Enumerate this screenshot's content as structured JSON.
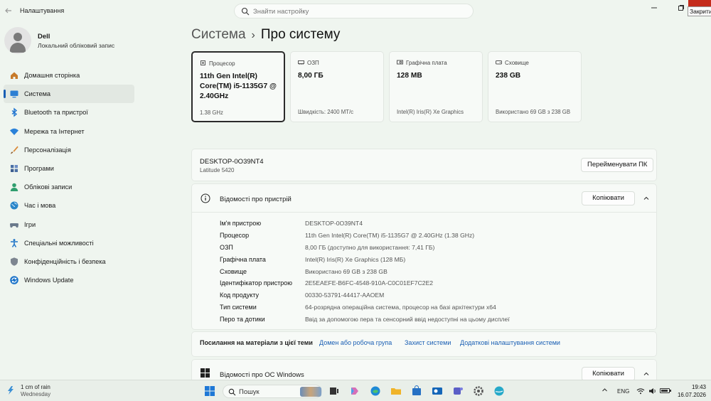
{
  "window": {
    "app_title": "Налаштування",
    "search_placeholder": "Знайти настройку",
    "close_tooltip": "Закрити"
  },
  "profile": {
    "name": "Dell",
    "account_type": "Локальний обліковий запис"
  },
  "sidebar": {
    "items": [
      {
        "label": "Домашня сторінка",
        "icon": "home-icon"
      },
      {
        "label": "Система",
        "icon": "system-icon",
        "active": true
      },
      {
        "label": "Bluetooth та пристрої",
        "icon": "bluetooth-icon"
      },
      {
        "label": "Мережа та Інтернет",
        "icon": "wifi-icon"
      },
      {
        "label": "Персоналізація",
        "icon": "brush-icon"
      },
      {
        "label": "Програми",
        "icon": "apps-icon"
      },
      {
        "label": "Облікові записи",
        "icon": "accounts-icon"
      },
      {
        "label": "Час і мова",
        "icon": "time-language-icon"
      },
      {
        "label": "Ігри",
        "icon": "gaming-icon"
      },
      {
        "label": "Спеціальні можливості",
        "icon": "accessibility-icon"
      },
      {
        "label": "Конфіденційність і безпека",
        "icon": "shield-icon"
      },
      {
        "label": "Windows Update",
        "icon": "windows-update-icon"
      }
    ]
  },
  "breadcrumb": {
    "parent": "Система",
    "separator": "›",
    "current": "Про систему"
  },
  "cards": [
    {
      "title": "Процесор",
      "value": "11th Gen Intel(R) Core(TM) i5-1135G7 @ 2.40GHz",
      "sub": "1.38 GHz",
      "icon": "cpu-icon"
    },
    {
      "title": "ОЗП",
      "value": "8,00 ГБ",
      "sub": "Швидкість: 2400 MT/c",
      "icon": "ram-icon"
    },
    {
      "title": "Графічна плата",
      "value": "128 MB",
      "sub": "Intel(R) Iris(R) Xe Graphics",
      "icon": "gpu-icon"
    },
    {
      "title": "Сховище",
      "value": "238 GB",
      "sub": "Використано 69 GB з 238 GB",
      "icon": "storage-icon"
    }
  ],
  "device": {
    "name": "DESKTOP-0O39NT4",
    "model": "Latitude 5420",
    "rename_label": "Перейменувати ПК"
  },
  "specs": {
    "title": "Відомості про пристрій",
    "copy_label": "Копіювати",
    "rows": [
      {
        "key": "Ім'я пристрою",
        "value": "DESKTOP-0O39NT4"
      },
      {
        "key": "Процесор",
        "value": "11th Gen Intel(R) Core(TM) i5-1135G7 @ 2.40GHz (1.38 GHz)"
      },
      {
        "key": "ОЗП",
        "value": "8,00 ГБ (доступно для використання: 7,41 ГБ)"
      },
      {
        "key": "Графічна плата",
        "value": "Intel(R) Iris(R) Xe Graphics (128 МБ)"
      },
      {
        "key": "Сховище",
        "value": "Використано 69 GB з 238 GB"
      },
      {
        "key": "Ідентифікатор пристрою",
        "value": "2E5EAEFE-B6FC-4548-910A-C0C01EF7C2E2"
      },
      {
        "key": "Код продукту",
        "value": "00330-53791-44417-AAOEM"
      },
      {
        "key": "Тип системи",
        "value": "64-розрядна операційна система, процесор на базі архітектури x64"
      },
      {
        "key": "Перо та дотики",
        "value": "Ввід за допомогою пера та сенсорний ввід недоступні на цьому дисплеї"
      }
    ]
  },
  "related_links": {
    "title": "Посилання на матеріали з цієї теми",
    "links": [
      "Домен або робоча група",
      "Захист системи",
      "Додаткові налаштування системи"
    ]
  },
  "windows_spec": {
    "title": "Відомості про ОС Windows",
    "copy_label": "Копіювати"
  },
  "taskbar": {
    "weather_main": "1 cm of rain",
    "weather_sub": "Wednesday",
    "search_label": "Пошук",
    "language": "ENG",
    "time": "19:43",
    "date": "16.07.2026",
    "battery_level": 0.85
  },
  "colors": {
    "accent": "#1a5fb4",
    "close_red": "#c42b1c",
    "background": "#eff5ef"
  }
}
